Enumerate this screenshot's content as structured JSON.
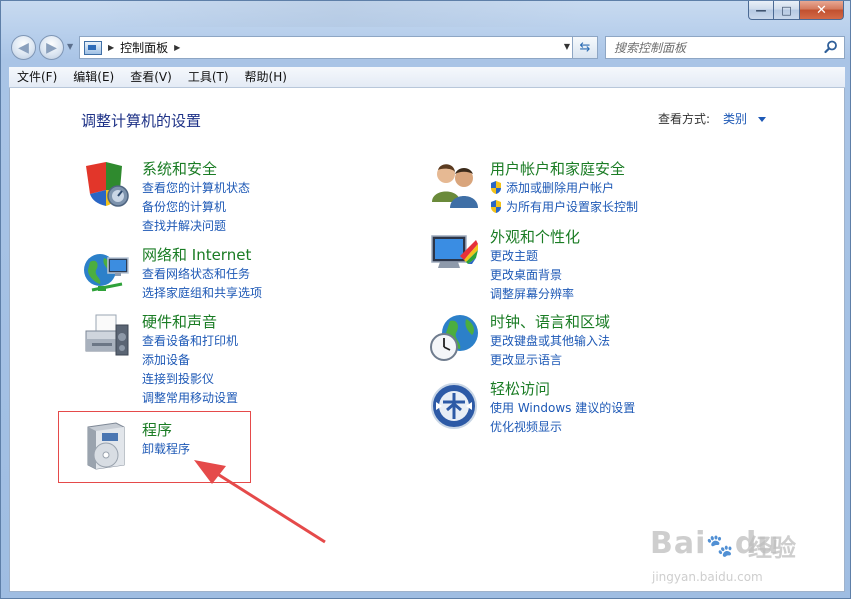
{
  "window": {
    "controls": {
      "minimize": "—",
      "maximize": "□",
      "close": "✕"
    }
  },
  "address_bar": {
    "breadcrumb": "控制面板",
    "search_placeholder": "搜索控制面板"
  },
  "menu": [
    "文件(F)",
    "编辑(E)",
    "查看(V)",
    "工具(T)",
    "帮助(H)"
  ],
  "content": {
    "title": "调整计算机的设置",
    "view_by_label": "查看方式:",
    "view_by_value": "类别",
    "categories": [
      {
        "title": "系统和安全",
        "links": [
          "查看您的计算机状态",
          "备份您的计算机",
          "查找并解决问题"
        ]
      },
      {
        "title": "网络和 Internet",
        "links": [
          "查看网络状态和任务",
          "选择家庭组和共享选项"
        ]
      },
      {
        "title": "硬件和声音",
        "links": [
          "查看设备和打印机",
          "添加设备",
          "连接到投影仪",
          "调整常用移动设置"
        ]
      },
      {
        "title": "程序",
        "links": [
          "卸载程序"
        ]
      },
      {
        "title": "用户帐户和家庭安全",
        "links": [
          "添加或删除用户帐户",
          "为所有用户设置家长控制"
        ]
      },
      {
        "title": "外观和个性化",
        "links": [
          "更改主题",
          "更改桌面背景",
          "调整屏幕分辨率"
        ]
      },
      {
        "title": "时钟、语言和区域",
        "links": [
          "更改键盘或其他输入法",
          "更改显示语言"
        ]
      },
      {
        "title": "轻松访问",
        "links": [
          "使用 Windows 建议的设置",
          "优化视频显示"
        ]
      }
    ]
  },
  "annotation": {
    "highlight_color": "#e54a4a"
  },
  "watermark": {
    "brand": "Bai",
    "brand2": "du",
    "suffix": "经验",
    "url": "jingyan.baidu.com"
  },
  "colors": {
    "title_blue": "#1e3287",
    "category_green": "#1a7c24",
    "link_blue": "#1e59b6"
  }
}
